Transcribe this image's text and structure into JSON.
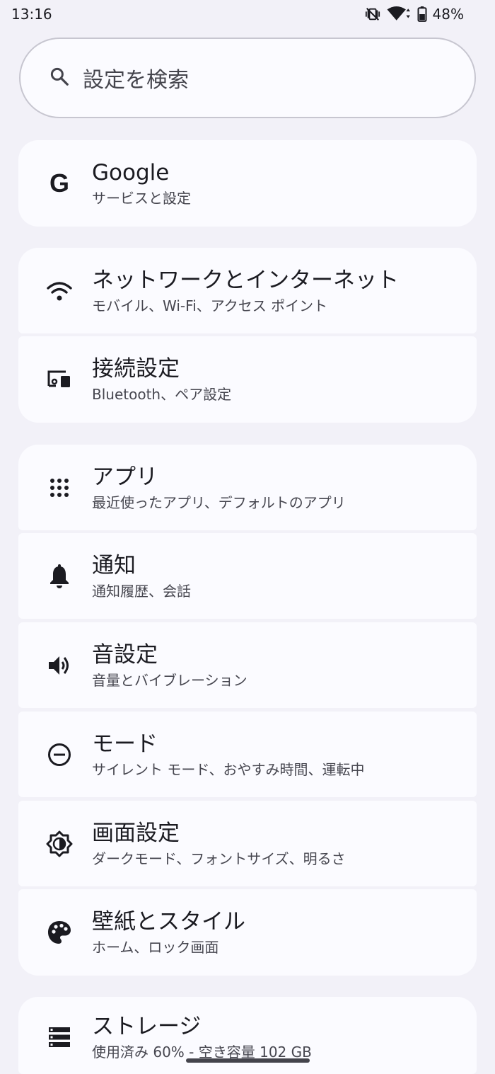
{
  "status_bar": {
    "time": "13:16",
    "battery": "48%"
  },
  "search": {
    "placeholder": "設定を検索"
  },
  "items": [
    {
      "title": "Google",
      "subtitle": "サービスと設定",
      "icon": "google-icon"
    },
    {
      "title": "ネットワークとインターネット",
      "subtitle": "モバイル、Wi-Fi、アクセス ポイント",
      "icon": "wifi-icon"
    },
    {
      "title": "接続設定",
      "subtitle": "Bluetooth、ペア設定",
      "icon": "devices-icon"
    },
    {
      "title": "アプリ",
      "subtitle": "最近使ったアプリ、デフォルトのアプリ",
      "icon": "apps-grid-icon"
    },
    {
      "title": "通知",
      "subtitle": "通知履歴、会話",
      "icon": "bell-icon"
    },
    {
      "title": "音設定",
      "subtitle": "音量とバイブレーション",
      "icon": "volume-icon"
    },
    {
      "title": "モード",
      "subtitle": "サイレント モード、おやすみ時間、運転中",
      "icon": "do-not-disturb-icon"
    },
    {
      "title": "画面設定",
      "subtitle": "ダークモード、フォントサイズ、明るさ",
      "icon": "brightness-icon"
    },
    {
      "title": "壁紙とスタイル",
      "subtitle": "ホーム、ロック画面",
      "icon": "palette-icon"
    },
    {
      "title": "ストレージ",
      "subtitle": "使用済み 60% - 空き容量 102 GB",
      "icon": "storage-icon"
    }
  ]
}
